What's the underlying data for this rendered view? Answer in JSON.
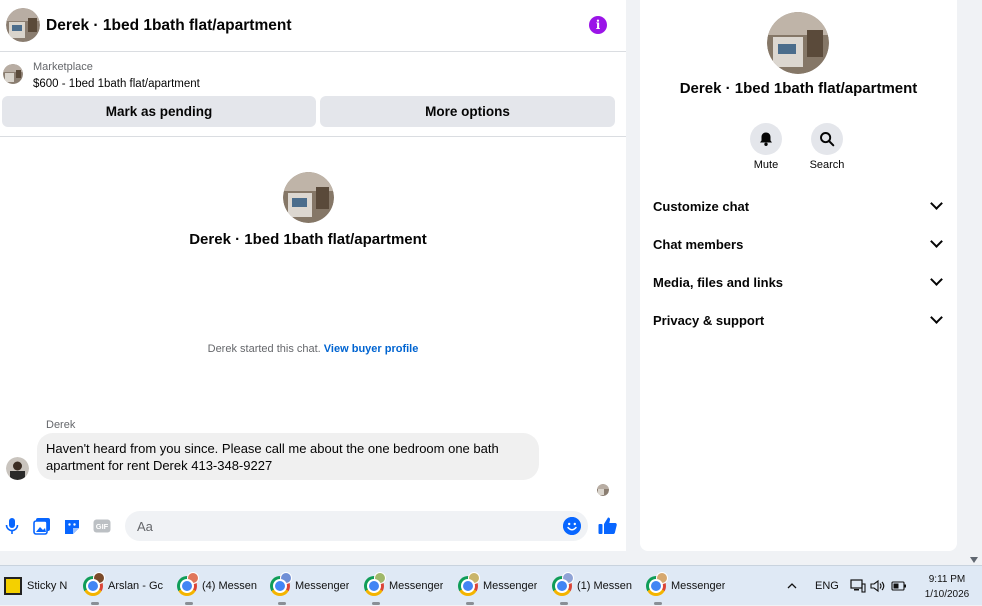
{
  "colors": {
    "accent": "#0866ff",
    "info_purple": "#9b14e8",
    "link_blue": "#0064d1",
    "panel_bg": "#ffffff",
    "page_bg": "#f0f2f5",
    "button_gray": "#e4e6eb"
  },
  "header": {
    "title": "Derek · 1bed 1bath flat/apartment",
    "info_icon": "info-icon",
    "info_glyph": "i"
  },
  "marketplace": {
    "label": "Marketplace",
    "price_line": "$600 - 1bed 1bath flat/apartment",
    "mark_pending": "Mark as pending",
    "more_options": "More options"
  },
  "intro": {
    "name": "Derek · 1bed 1bath flat/apartment",
    "started": "Derek started this chat.",
    "view_profile": "View buyer profile"
  },
  "messages": [
    {
      "sender": "Derek",
      "text": "Haven't heard from you since. Please call me about the one bedroom one bath apartment for rent Derek 413-348-9227"
    }
  ],
  "composer": {
    "placeholder": "Aa",
    "icons": [
      "microphone-icon",
      "photo-icon",
      "sticker-icon",
      "gif-icon",
      "emoji-icon",
      "thumbs-up-icon"
    ],
    "gif_label": "GIF"
  },
  "info_panel": {
    "name": "Derek · 1bed 1bath flat/apartment",
    "actions": [
      {
        "label": "Mute",
        "icon": "bell-icon"
      },
      {
        "label": "Search",
        "icon": "search-icon"
      }
    ],
    "sections": [
      {
        "label": "Customize chat"
      },
      {
        "label": "Chat members"
      },
      {
        "label": "Media, files and links"
      },
      {
        "label": "Privacy & support"
      }
    ]
  },
  "taskbar": {
    "items": [
      {
        "label": "Sticky N",
        "icon": "sticky-notes-icon"
      },
      {
        "label": "Arslan - Gc",
        "icon": "chrome-icon"
      },
      {
        "label": "(4) Messen",
        "icon": "chrome-icon"
      },
      {
        "label": "Messenger",
        "icon": "chrome-icon"
      },
      {
        "label": "Messenger",
        "icon": "chrome-icon"
      },
      {
        "label": "Messenger",
        "icon": "chrome-icon"
      },
      {
        "label": "(1) Messen",
        "icon": "chrome-icon"
      },
      {
        "label": "Messenger",
        "icon": "chrome-icon"
      }
    ],
    "tray": {
      "language": "ENG",
      "time": "9:11 PM",
      "date": "1/10/2026"
    }
  }
}
